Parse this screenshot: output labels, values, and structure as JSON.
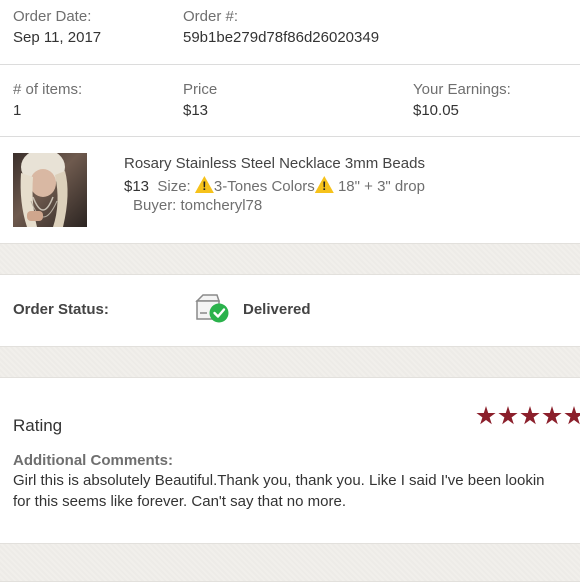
{
  "order": {
    "date_label": "Order Date:",
    "date_value": "Sep 11, 2017",
    "number_label": "Order #:",
    "number_value": "59b1be279d78f86d26020349"
  },
  "summary": {
    "items_label": "# of items:",
    "items_value": "1",
    "price_label": "Price",
    "price_value": "$13",
    "earnings_label": "Your Earnings:",
    "earnings_value": "$10.05"
  },
  "product": {
    "title": "Rosary Stainless Steel Necklace 3mm Beads",
    "price": "$13",
    "size_label": "Size:",
    "size_text_1": "3-Tones Colors",
    "size_text_2": "18\" + 3\" drop",
    "buyer": "Buyer: tomcheryl78",
    "warning_icon": "warning-triangle-icon"
  },
  "status": {
    "label": "Order Status:",
    "value": "Delivered",
    "icon": "package-delivered-icon",
    "check_color": "#2bb24c"
  },
  "rating": {
    "label": "Rating",
    "stars": 5,
    "star_color": "#8b1f2b",
    "comments_label": "Additional Comments:",
    "comment_line_1": "Girl this is absolutely Beautiful.Thank you, thank you. Like I said I've been lookin",
    "comment_line_2": "for this seems like forever. Can't say that no more."
  }
}
